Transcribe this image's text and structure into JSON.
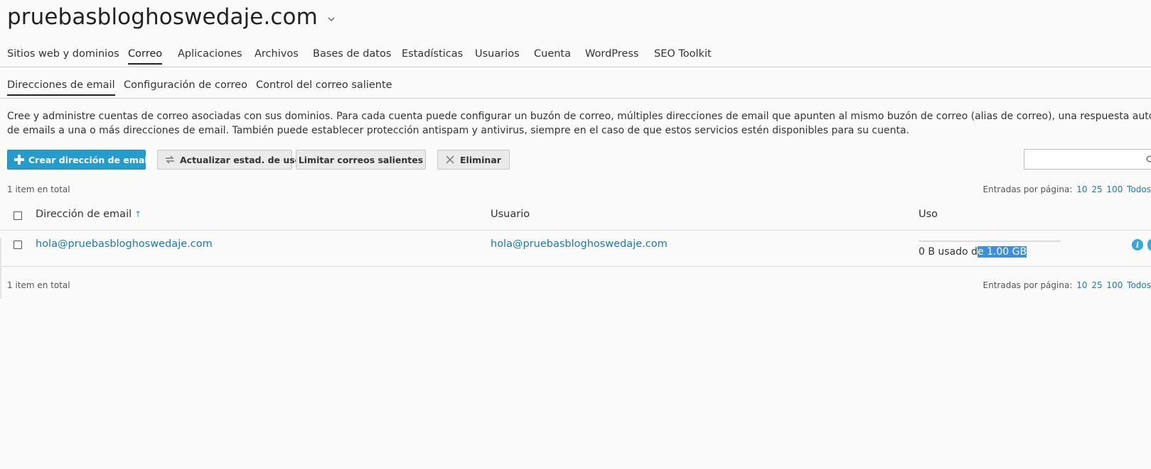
{
  "header": {
    "domain": "pruebasbloghoswedaje.com",
    "caret": "⌄"
  },
  "main_tabs": [
    {
      "label": "Sitios web y dominios",
      "active": false
    },
    {
      "label": "Correo",
      "active": true
    },
    {
      "label": "Aplicaciones",
      "active": false
    },
    {
      "label": "Archivos",
      "active": false
    },
    {
      "label": "Bases de datos",
      "active": false
    },
    {
      "label": "Estadísticas",
      "active": false
    },
    {
      "label": "Usuarios",
      "active": false
    },
    {
      "label": "Cuenta",
      "active": false
    },
    {
      "label": "WordPress",
      "active": false
    },
    {
      "label": "SEO Toolkit",
      "active": false
    }
  ],
  "sub_tabs": [
    {
      "label": "Direcciones de email",
      "active": true
    },
    {
      "label": "Configuración de correo",
      "active": false
    },
    {
      "label": "Control del correo saliente",
      "active": false
    }
  ],
  "description": {
    "line1": "Cree y administre cuentas de correo asociadas con sus dominios. Para cada cuenta puede configurar un buzón de correo, múltiples direcciones de email que apunten al mismo buzón de correo (alias de correo), una respuesta automática y el reenvío",
    "line2": "de emails a una o más direcciones de email. También puede establecer protección antispam y antivirus, siempre en el caso de que estos servicios estén disponibles para su cuenta."
  },
  "toolbar": {
    "create": "Crear dirección de email",
    "update_usage": "Actualizar estad. de uso",
    "limit_outgoing": "Limitar correos salientes",
    "delete": "Eliminar",
    "search_placeholder": ""
  },
  "list": {
    "total": "1 item en total",
    "per_page_label": "Entradas por página:",
    "per_page_options": [
      "10",
      "25",
      "100",
      "Todos"
    ],
    "columns": {
      "email": "Dirección de email",
      "user": "Usuario",
      "usage": "Uso"
    },
    "rows": [
      {
        "email": "hola@pruebasbloghoswedaje.com",
        "user": "hola@pruebasbloghoswedaje.com",
        "usage_prefix": "0 B usado d",
        "usage_selected": "e 1.00 GB",
        "usage_fraction": 0
      }
    ]
  },
  "colors": {
    "accent": "#259ccc",
    "link": "#1a7ab0",
    "selection": "#3d8ee0"
  }
}
